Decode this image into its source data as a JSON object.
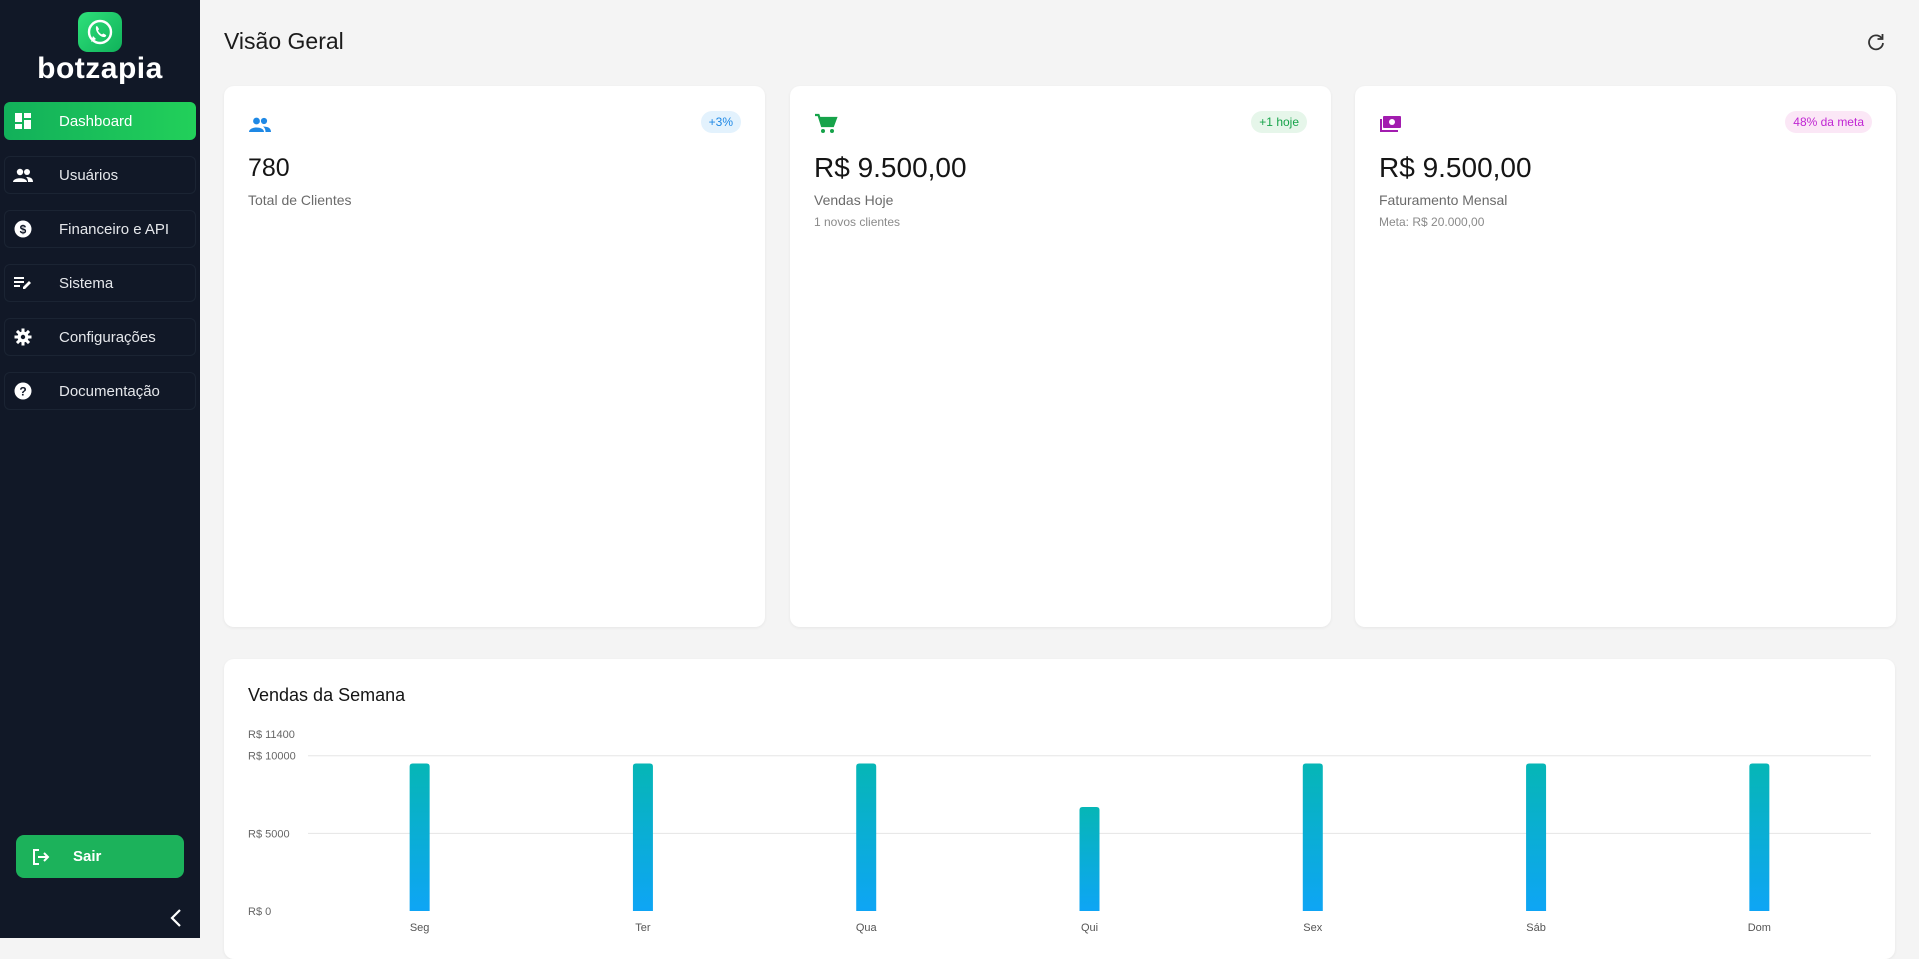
{
  "app": {
    "brand": "botzapia"
  },
  "sidebar": {
    "items": [
      {
        "label": "Dashboard",
        "icon": "dashboard-icon",
        "active": true
      },
      {
        "label": "Usuários",
        "icon": "users-icon"
      },
      {
        "label": "Financeiro e API",
        "icon": "dollar-icon"
      },
      {
        "label": "Sistema",
        "icon": "edit-list-icon"
      },
      {
        "label": "Configurações",
        "icon": "gear-icon"
      },
      {
        "label": "Documentação",
        "icon": "help-icon"
      }
    ],
    "logout_label": "Sair"
  },
  "header": {
    "title": "Visão Geral"
  },
  "cards": [
    {
      "value": "780",
      "label": "Total de Clientes",
      "badge": "+3%",
      "sub": "",
      "icon": "users-icon",
      "accent": "#1e88e5"
    },
    {
      "value": "R$ 9.500,00",
      "label": "Vendas Hoje",
      "badge": "+1 hoje",
      "sub": "1 novos clientes",
      "icon": "cart-icon",
      "accent": "#16a34a"
    },
    {
      "value": "R$ 9.500,00",
      "label": "Faturamento Mensal",
      "badge": "48% da meta",
      "sub": "Meta: R$ 20.000,00",
      "icon": "money-icon",
      "accent": "#a21caf"
    }
  ],
  "chart": {
    "title": "Vendas da Semana"
  },
  "chart_data": {
    "type": "bar",
    "categories": [
      "Seg",
      "Ter",
      "Qua",
      "Qui",
      "Sex",
      "Sáb",
      "Dom"
    ],
    "values": [
      9500,
      9500,
      9500,
      6700,
      9500,
      9500,
      9500
    ],
    "ylim": [
      0,
      11400
    ],
    "yticks": [
      0,
      5000,
      10000,
      11400
    ],
    "ytick_labels": [
      "R$ 0",
      "R$ 5000",
      "R$ 10000",
      "R$ 11400"
    ],
    "bar_colors": [
      "#06b6b6",
      "#0ea5f5"
    ],
    "grid": true
  }
}
